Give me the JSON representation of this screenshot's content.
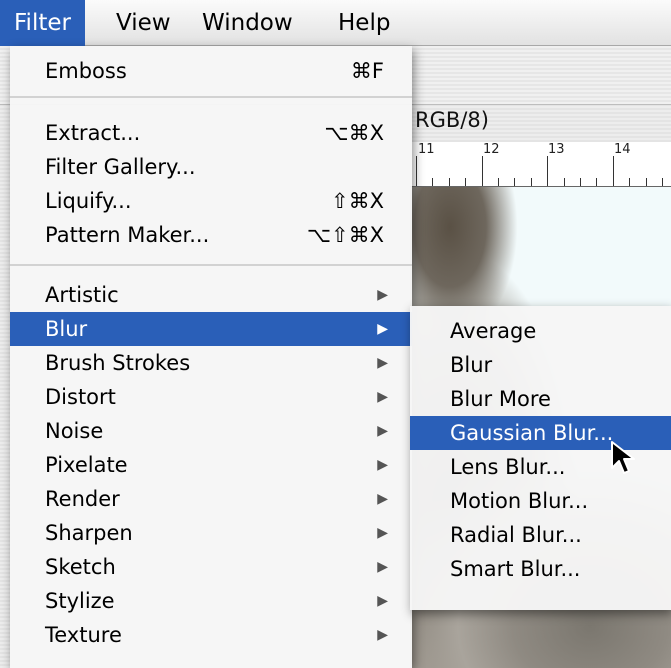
{
  "menubar": {
    "items": [
      "Filter",
      "View",
      "Window",
      "Help"
    ],
    "active": "Filter"
  },
  "document": {
    "title_fragment": "RGB/8)",
    "ruler_numbers": [
      "11",
      "12",
      "13",
      "14"
    ]
  },
  "filter_menu": {
    "items": [
      {
        "label": "Emboss",
        "shortcut": "⌘F"
      },
      {
        "label": "Extract...",
        "shortcut": "⌥⌘X"
      },
      {
        "label": "Filter Gallery...",
        "shortcut": ""
      },
      {
        "label": "Liquify...",
        "shortcut": "⇧⌘X"
      },
      {
        "label": "Pattern Maker...",
        "shortcut": "⌥⇧⌘X"
      },
      {
        "label": "Artistic",
        "submenu": true
      },
      {
        "label": "Blur",
        "submenu": true,
        "highlighted": true
      },
      {
        "label": "Brush Strokes",
        "submenu": true
      },
      {
        "label": "Distort",
        "submenu": true
      },
      {
        "label": "Noise",
        "submenu": true
      },
      {
        "label": "Pixelate",
        "submenu": true
      },
      {
        "label": "Render",
        "submenu": true
      },
      {
        "label": "Sharpen",
        "submenu": true
      },
      {
        "label": "Sketch",
        "submenu": true
      },
      {
        "label": "Stylize",
        "submenu": true
      },
      {
        "label": "Texture",
        "submenu": true
      }
    ]
  },
  "blur_submenu": {
    "items": [
      {
        "label": "Average"
      },
      {
        "label": "Blur"
      },
      {
        "label": "Blur More"
      },
      {
        "label": "Gaussian Blur...",
        "highlighted": true
      },
      {
        "label": "Lens Blur..."
      },
      {
        "label": "Motion Blur..."
      },
      {
        "label": "Radial Blur..."
      },
      {
        "label": "Smart Blur..."
      }
    ]
  },
  "icons": {
    "submenu_arrow": "triangle-right-icon",
    "cursor": "arrow-cursor-icon"
  },
  "colors": {
    "highlight": "#2a5fb8"
  }
}
